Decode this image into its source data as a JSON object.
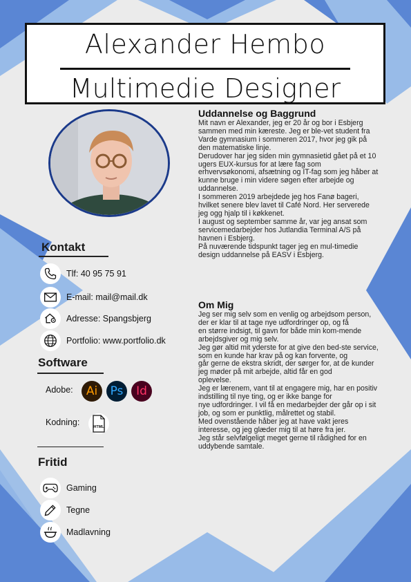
{
  "header": {
    "name": "Alexander Hembo",
    "title": "Multimedie Designer"
  },
  "colors": {
    "accent_dark": "#1b3a8a",
    "accent_mid": "#5a86d4",
    "accent_light": "#98bbe8",
    "background": "#ebebeb"
  },
  "contact": {
    "heading": "Kontakt",
    "items": [
      {
        "icon": "phone-icon",
        "text": "Tlf: 40 95 75 91"
      },
      {
        "icon": "email-icon",
        "text": "E-mail: mail@mail.dk"
      },
      {
        "icon": "home-location-icon",
        "text": "Adresse: Spangsbjerg"
      },
      {
        "icon": "globe-icon",
        "text": "Portfolio: www.portfolio.dk"
      }
    ]
  },
  "software": {
    "heading": "Software",
    "adobe_label": "Adobe:",
    "adobe_apps": [
      {
        "abbr": "Ai",
        "bg": "#2e1a05",
        "fg": "#ff9a00"
      },
      {
        "abbr": "Ps",
        "bg": "#001d34",
        "fg": "#31a8ff"
      },
      {
        "abbr": "Id",
        "bg": "#49021f",
        "fg": "#ff3366"
      }
    ],
    "coding_label": "Kodning:",
    "coding_icon_text": "HTML"
  },
  "fritid": {
    "heading": "Fritid",
    "items": [
      {
        "icon": "gamepad-icon",
        "text": "Gaming"
      },
      {
        "icon": "pencil-icon",
        "text": "Tegne"
      },
      {
        "icon": "cooking-icon",
        "text": "Madlavning"
      }
    ]
  },
  "education": {
    "heading": "Uddannelse og Baggrund",
    "paragraphs": [
      "Mit navn er Alexander, jeg er 20 år og bor i Esbjerg sammen med min kæreste. Jeg er ble-vet student fra Varde gymnasium i sommeren 2017, hvor jeg gik på den matematiske linje.",
      "Derudover har jeg siden min gymnasietid gået på et 10 ugers EUX-kursus for at lære fag som erhvervsøkonomi, afsætning og IT-fag som jeg håber at kunne bruge i min videre søgen efter arbejde og uddannelse.",
      "I sommeren 2019 arbejdede jeg hos Fanø bageri, hvilket senere blev lavet til Café Nord. Her serverede jeg ogg hjalp til i køkkenet.",
      "I august og september samme år, var jeg ansat som servicemedarbejder hos Jutlandia Terminal A/S på havnen i Esbjerg.",
      "På nuværende tidspunkt tager jeg en mul-timedie design uddannelse på EASV i Esbjerg."
    ]
  },
  "about": {
    "heading": "Om Mig",
    "paragraphs": [
      "Jeg ser mig selv som en venlig og arbejdsom person, der er klar til at tage nye udfordringer op, og få",
      "en større indsigt, til gavn for både min kom-mende arbejdsgiver og mig selv.",
      "Jeg gør altid mit yderste for at give den bed-ste service, som en kunde har krav på og kan forvente, og",
      "går gerne de ekstra skridt, der sørger for, at de kunder jeg møder på mit arbejde, altid får en god",
      "oplevelse.",
      "Jeg er lærenem, vant til at engagere mig, har en positiv indstilling til nye ting, og er ikke bange for",
      "nye udfordringer. I vil få en medarbejder der går op i sit job, og som er punktlig, målrettet og stabil.",
      "Med ovenstående håber jeg at have vakt jeres interesse, og jeg glæder mig til at høre fra jer.",
      "Jeg står selvfølgeligt meget gerne til rådighed for en uddybende samtale."
    ]
  }
}
